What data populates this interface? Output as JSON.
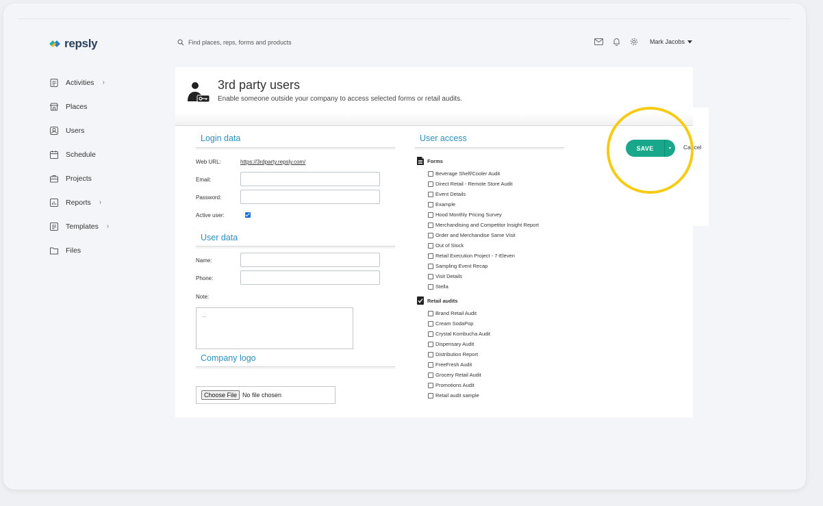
{
  "app": {
    "brand": "repsly"
  },
  "search": {
    "placeholder": "Find places, reps, forms and products"
  },
  "user": {
    "name": "Mark Jacobs"
  },
  "sidebar": {
    "items": [
      {
        "label": "Activities",
        "icon": "activities-icon",
        "has_chevron": true
      },
      {
        "label": "Places",
        "icon": "store-icon",
        "has_chevron": false
      },
      {
        "label": "Users",
        "icon": "user-icon",
        "has_chevron": false
      },
      {
        "label": "Schedule",
        "icon": "calendar-icon",
        "has_chevron": false
      },
      {
        "label": "Projects",
        "icon": "briefcase-icon",
        "has_chevron": false
      },
      {
        "label": "Reports",
        "icon": "chart-icon",
        "has_chevron": true
      },
      {
        "label": "Templates",
        "icon": "template-icon",
        "has_chevron": true
      },
      {
        "label": "Files",
        "icon": "folder-icon",
        "has_chevron": false
      }
    ],
    "chevron": "›"
  },
  "page": {
    "title": "3rd party users",
    "subtitle": "Enable someone outside your company to access selected forms or retail audits."
  },
  "login": {
    "section_title": "Login data",
    "web_url_label": "Web URL:",
    "web_url_value": "https://3rdparty.repsly.com/",
    "email_label": "Email:",
    "email_value": "",
    "password_label": "Password:",
    "password_value": "",
    "active_label": "Active user:",
    "active_checked": true
  },
  "user_data": {
    "section_title": "User data",
    "name_label": "Name:",
    "name_value": "",
    "phone_label": "Phone:",
    "phone_value": "",
    "note_label": "Note:",
    "note_placeholder": "..."
  },
  "company_logo": {
    "section_title": "Company logo",
    "choose_label": "Choose File",
    "file_status": "No file chosen"
  },
  "user_access": {
    "section_title": "User access",
    "forms": {
      "title": "Forms",
      "items": [
        "Beverage Shelf/Cooler Audit",
        "Direct Retail - Remote Store Audit",
        "Event Details",
        "Example",
        "Hood Monthly Pricing Survey",
        "Merchandising and Competitor Insight Report",
        "Order and Merchandise Same Visit",
        "Out of Stock",
        "Retail Execution Project - 7-Eleven",
        "Sampling Event Recap",
        "Visit Details",
        "Stella"
      ]
    },
    "retail_audits": {
      "title": "Retail audits",
      "items": [
        "Brand Retail Audit",
        "Cream SodaPop",
        "Crystal Kombucha Audit",
        "Dispensary Audit",
        "Distribution Report",
        "FreeFresh Audit",
        "Grocery Retail Audit",
        "Promotions Audit",
        "Retail audit sample"
      ]
    }
  },
  "actions": {
    "save_label": "SAVE",
    "save_caret": "▾",
    "cancel_label": "Cancel"
  },
  "colors": {
    "accent": "#18a78a",
    "section_title": "#2b8fbc",
    "highlight": "#f7cb13",
    "brand_text": "#2a3f5c"
  }
}
